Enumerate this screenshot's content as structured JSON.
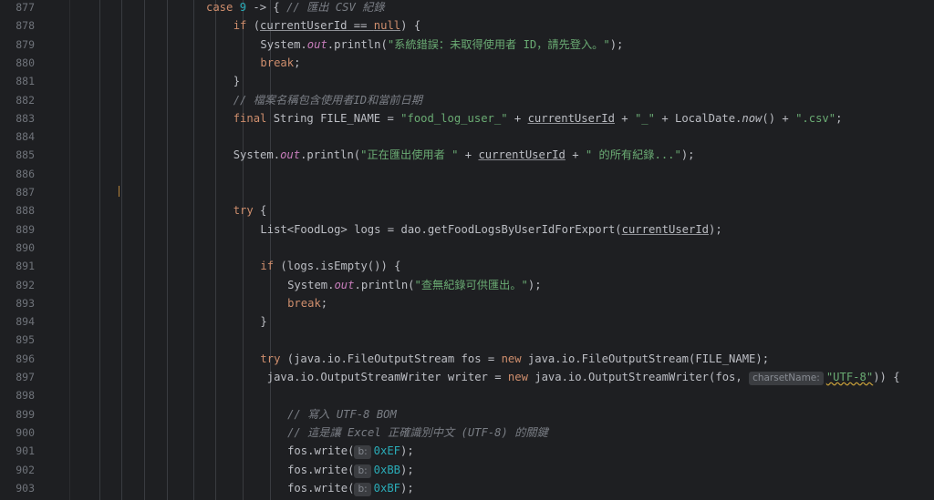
{
  "editor": {
    "colors": {
      "background": "#1e1f22",
      "keyword": "#cf8e6d",
      "string": "#6aab73",
      "comment": "#7a7e85",
      "number": "#2aacb8",
      "static_field": "#c77dbb",
      "line_number": "#6f737a",
      "hint_bg": "#3b3d41"
    },
    "lines": [
      {
        "n": "877",
        "indent": 0,
        "tokens": [
          {
            "t": "kw",
            "v": "case "
          },
          {
            "t": "num",
            "v": "9"
          },
          {
            "t": "pl",
            "v": " -> { "
          },
          {
            "t": "cm",
            "v": "// 匯出 CSV 紀錄"
          }
        ]
      },
      {
        "n": "878",
        "indent": 1,
        "tokens": [
          {
            "t": "kw",
            "v": "if "
          },
          {
            "t": "pl",
            "v": "("
          },
          {
            "t": "ul",
            "v": "currentUserId"
          },
          {
            "t": "ul",
            "v": " == "
          },
          {
            "t": "kwul",
            "v": "null"
          },
          {
            "t": "pl",
            "v": ") {"
          }
        ]
      },
      {
        "n": "879",
        "indent": 2,
        "tokens": [
          {
            "t": "pl",
            "v": "System."
          },
          {
            "t": "fld",
            "v": "out"
          },
          {
            "t": "pl",
            "v": ".println("
          },
          {
            "t": "str",
            "v": "\"系統錯誤：未取得使用者 ID，請先登入。\""
          },
          {
            "t": "pl",
            "v": ");"
          }
        ]
      },
      {
        "n": "880",
        "indent": 2,
        "tokens": [
          {
            "t": "kw",
            "v": "break"
          },
          {
            "t": "pl",
            "v": ";"
          }
        ]
      },
      {
        "n": "881",
        "indent": 1,
        "tokens": [
          {
            "t": "pl",
            "v": "}"
          }
        ]
      },
      {
        "n": "882",
        "indent": 1,
        "tokens": [
          {
            "t": "cm",
            "v": "// 檔案名稱包含使用者ID和當前日期"
          }
        ]
      },
      {
        "n": "883",
        "indent": 1,
        "tokens": [
          {
            "t": "kw",
            "v": "final "
          },
          {
            "t": "pl",
            "v": "String FILE_NAME = "
          },
          {
            "t": "str",
            "v": "\"food_log_user_\""
          },
          {
            "t": "pl",
            "v": " + "
          },
          {
            "t": "ul",
            "v": "currentUserId"
          },
          {
            "t": "pl",
            "v": " + "
          },
          {
            "t": "str",
            "v": "\"_\""
          },
          {
            "t": "pl",
            "v": " + LocalDate."
          },
          {
            "t": "st",
            "v": "now"
          },
          {
            "t": "pl",
            "v": "() + "
          },
          {
            "t": "str",
            "v": "\".csv\""
          },
          {
            "t": "pl",
            "v": ";"
          }
        ]
      },
      {
        "n": "884",
        "indent": 1,
        "tokens": []
      },
      {
        "n": "885",
        "indent": 1,
        "tokens": [
          {
            "t": "pl",
            "v": "System."
          },
          {
            "t": "fld",
            "v": "out"
          },
          {
            "t": "pl",
            "v": ".println("
          },
          {
            "t": "str",
            "v": "\"正在匯出使用者 \""
          },
          {
            "t": "pl",
            "v": " + "
          },
          {
            "t": "ul",
            "v": "currentUserId"
          },
          {
            "t": "pl",
            "v": " + "
          },
          {
            "t": "str",
            "v": "\" 的所有紀錄...\""
          },
          {
            "t": "pl",
            "v": ");"
          }
        ]
      },
      {
        "n": "886",
        "indent": 1,
        "tokens": []
      },
      {
        "n": "887",
        "indent": 1,
        "tokens": []
      },
      {
        "n": "888",
        "indent": 1,
        "tokens": [
          {
            "t": "kw",
            "v": "try "
          },
          {
            "t": "pl",
            "v": "{"
          }
        ]
      },
      {
        "n": "889",
        "indent": 2,
        "tokens": [
          {
            "t": "pl",
            "v": "List<FoodLog> logs = dao.getFoodLogsByUserIdForExport("
          },
          {
            "t": "ul",
            "v": "currentUserId"
          },
          {
            "t": "pl",
            "v": ");"
          }
        ]
      },
      {
        "n": "890",
        "indent": 2,
        "tokens": []
      },
      {
        "n": "891",
        "indent": 2,
        "tokens": [
          {
            "t": "kw",
            "v": "if "
          },
          {
            "t": "pl",
            "v": "(logs.isEmpty()) {"
          }
        ]
      },
      {
        "n": "892",
        "indent": 3,
        "tokens": [
          {
            "t": "pl",
            "v": "System."
          },
          {
            "t": "fld",
            "v": "out"
          },
          {
            "t": "pl",
            "v": ".println("
          },
          {
            "t": "str",
            "v": "\"查無紀錄可供匯出。\""
          },
          {
            "t": "pl",
            "v": ");"
          }
        ]
      },
      {
        "n": "893",
        "indent": 3,
        "tokens": [
          {
            "t": "kw",
            "v": "break"
          },
          {
            "t": "pl",
            "v": ";"
          }
        ]
      },
      {
        "n": "894",
        "indent": 2,
        "tokens": [
          {
            "t": "pl",
            "v": "}"
          }
        ]
      },
      {
        "n": "895",
        "indent": 2,
        "tokens": []
      },
      {
        "n": "896",
        "indent": 2,
        "tokens": [
          {
            "t": "kw",
            "v": "try "
          },
          {
            "t": "pl",
            "v": "(java.io.FileOutputStream fos = "
          },
          {
            "t": "kw",
            "v": "new "
          },
          {
            "t": "pl",
            "v": "java.io.FileOutputStream(FILE_NAME);"
          }
        ]
      },
      {
        "n": "897",
        "indent": 2,
        "pad": " ",
        "tokens": [
          {
            "t": "pl",
            "v": "java.io.OutputStreamWriter writer = "
          },
          {
            "t": "kw",
            "v": "new "
          },
          {
            "t": "pl",
            "v": "java.io.OutputStreamWriter(fos, "
          },
          {
            "t": "hint",
            "v": "charsetName:"
          },
          {
            "t": "strwavy",
            "v": "\"UTF-8\""
          },
          {
            "t": "pl",
            "v": ")) {"
          }
        ]
      },
      {
        "n": "898",
        "indent": 2,
        "tokens": []
      },
      {
        "n": "899",
        "indent": 3,
        "tokens": [
          {
            "t": "cm",
            "v": "// 寫入 UTF-8 BOM"
          }
        ]
      },
      {
        "n": "900",
        "indent": 3,
        "tokens": [
          {
            "t": "cm",
            "v": "// 這是讓 Excel 正確識別中文 (UTF-8) 的關鍵"
          }
        ]
      },
      {
        "n": "901",
        "indent": 3,
        "tokens": [
          {
            "t": "pl",
            "v": "fos.write("
          },
          {
            "t": "hint",
            "v": "b:"
          },
          {
            "t": "num",
            "v": "0xEF"
          },
          {
            "t": "pl",
            "v": ");"
          }
        ]
      },
      {
        "n": "902",
        "indent": 3,
        "tokens": [
          {
            "t": "pl",
            "v": "fos.write("
          },
          {
            "t": "hint",
            "v": "b:"
          },
          {
            "t": "num",
            "v": "0xBB"
          },
          {
            "t": "pl",
            "v": ");"
          }
        ]
      },
      {
        "n": "903",
        "indent": 3,
        "tokens": [
          {
            "t": "pl",
            "v": "fos.write("
          },
          {
            "t": "hint",
            "v": "b:"
          },
          {
            "t": "num",
            "v": "0xBF"
          },
          {
            "t": "pl",
            "v": ");"
          }
        ]
      }
    ]
  }
}
